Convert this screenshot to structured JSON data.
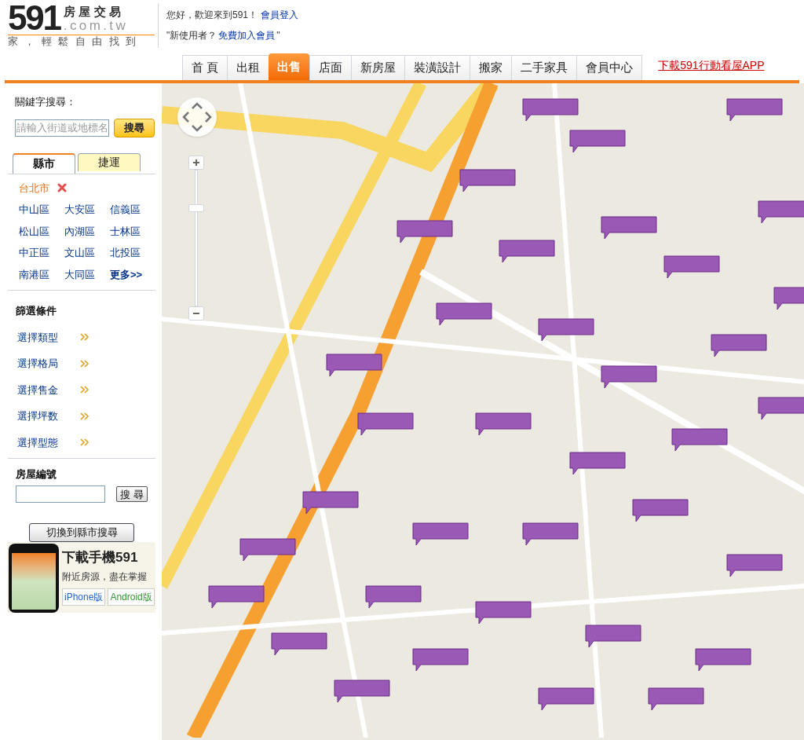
{
  "header": {
    "logo": {
      "number": "591",
      "domain_top": "房屋交易",
      "domain_bottom": ".com.tw",
      "slogan": "家，輕鬆自由找到"
    },
    "greeting": "您好，歡迎來到591！",
    "login_link": "會員登入",
    "new_user_prompt": "\"新使用者？",
    "signup_link": "免費加入會員",
    "closing_quote": "\""
  },
  "nav": {
    "tabs": [
      {
        "label": "首 頁",
        "selected": false
      },
      {
        "label": "出租",
        "selected": false
      },
      {
        "label": "出售",
        "selected": true
      },
      {
        "label": "店面",
        "selected": false
      },
      {
        "label": "新房屋",
        "selected": false
      },
      {
        "label": "裝潢設計",
        "selected": false
      },
      {
        "label": "搬家",
        "selected": false
      },
      {
        "label": "二手家具",
        "selected": false
      },
      {
        "label": "會員中心",
        "selected": false
      }
    ],
    "app_link": "下載591行動看屋APP"
  },
  "sidebar": {
    "keyword_label": "關鍵字搜尋：",
    "keyword_placeholder": "請輸入街道或地標名",
    "search_button": "搜尋",
    "region_tabs": [
      {
        "label": "縣市",
        "selected": true
      },
      {
        "label": "捷運",
        "selected": false
      }
    ],
    "selected_city": "台北市",
    "districts": [
      "中山區",
      "大安區",
      "信義區",
      "松山區",
      "內湖區",
      "士林區",
      "中正區",
      "文山區",
      "北投區",
      "南港區",
      "大同區",
      "更多>>"
    ],
    "filter_title": "篩選條件",
    "filters": [
      "選擇類型",
      "選擇格局",
      "選擇售金",
      "選擇坪数",
      "選擇型態"
    ],
    "house_id_title": "房屋編號",
    "house_id_button": "搜 尋",
    "switch_button": "切換到縣市搜尋",
    "app_promo": {
      "title": "下載手機591",
      "subtitle": "附近房源，盡在掌握",
      "buttons": [
        "iPhone版",
        "Android版"
      ]
    }
  },
  "map": {
    "zoom": {
      "level": 0.73
    }
  }
}
